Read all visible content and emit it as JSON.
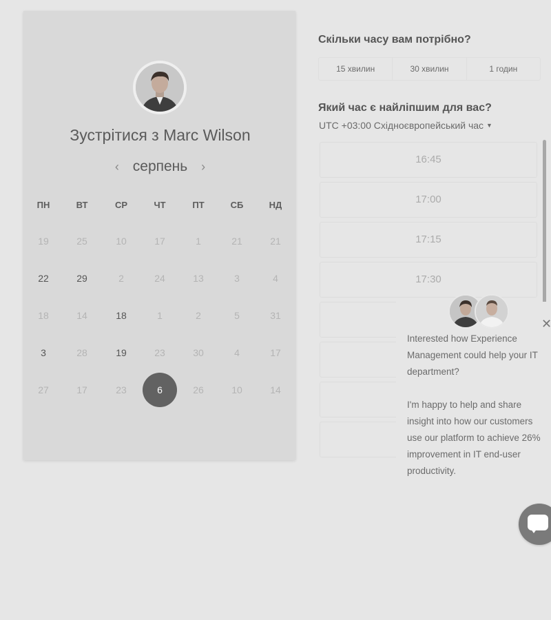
{
  "host": {
    "title": "Зустрітися з Marc Wilson",
    "avatar_icon": "person-avatar"
  },
  "calendar": {
    "month": "серпень",
    "prev_icon": "chevron-left-icon",
    "next_icon": "chevron-right-icon",
    "weekdays": [
      "ПН",
      "ВТ",
      "СР",
      "ЧТ",
      "ПТ",
      "СБ",
      "НД"
    ],
    "weeks": [
      [
        "19",
        "25",
        "10",
        "17",
        "1",
        "21",
        "21"
      ],
      [
        "22",
        "29",
        "2",
        "24",
        "13",
        "3",
        "4"
      ],
      [
        "18",
        "14",
        "18",
        "1",
        "2",
        "5",
        "31"
      ],
      [
        "3",
        "28",
        "19",
        "23",
        "30",
        "4",
        "17"
      ],
      [
        "27",
        "17",
        "23",
        "6",
        "26",
        "10",
        "14"
      ]
    ],
    "available": [
      "1-0",
      "1-1",
      "2-2",
      "3-0",
      "3-2"
    ],
    "selected": "4-3"
  },
  "duration": {
    "question": "Скільки часу вам потрібно?",
    "options": [
      "15 хвилин",
      "30 хвилин",
      "1 годин"
    ]
  },
  "time": {
    "question": "Який час є найліпшим для вас?",
    "timezone": "UTC +03:00 Східноєвропейський час",
    "slots": [
      "16:45",
      "17:00",
      "17:15",
      "17:30",
      "",
      "",
      "",
      ""
    ]
  },
  "chat": {
    "message1": "Interested how Experience Management could help your IT department?",
    "message2": "I'm happy to help and share insight into how our customers use our platform to achieve 26% improvement in IT end-user productivity.",
    "close_icon": "close-icon",
    "launcher_icon": "chat-bubble-icon"
  },
  "colors": {
    "background": "#e6e6e6",
    "card": "#d9d9d9",
    "selected_day": "#626262"
  }
}
